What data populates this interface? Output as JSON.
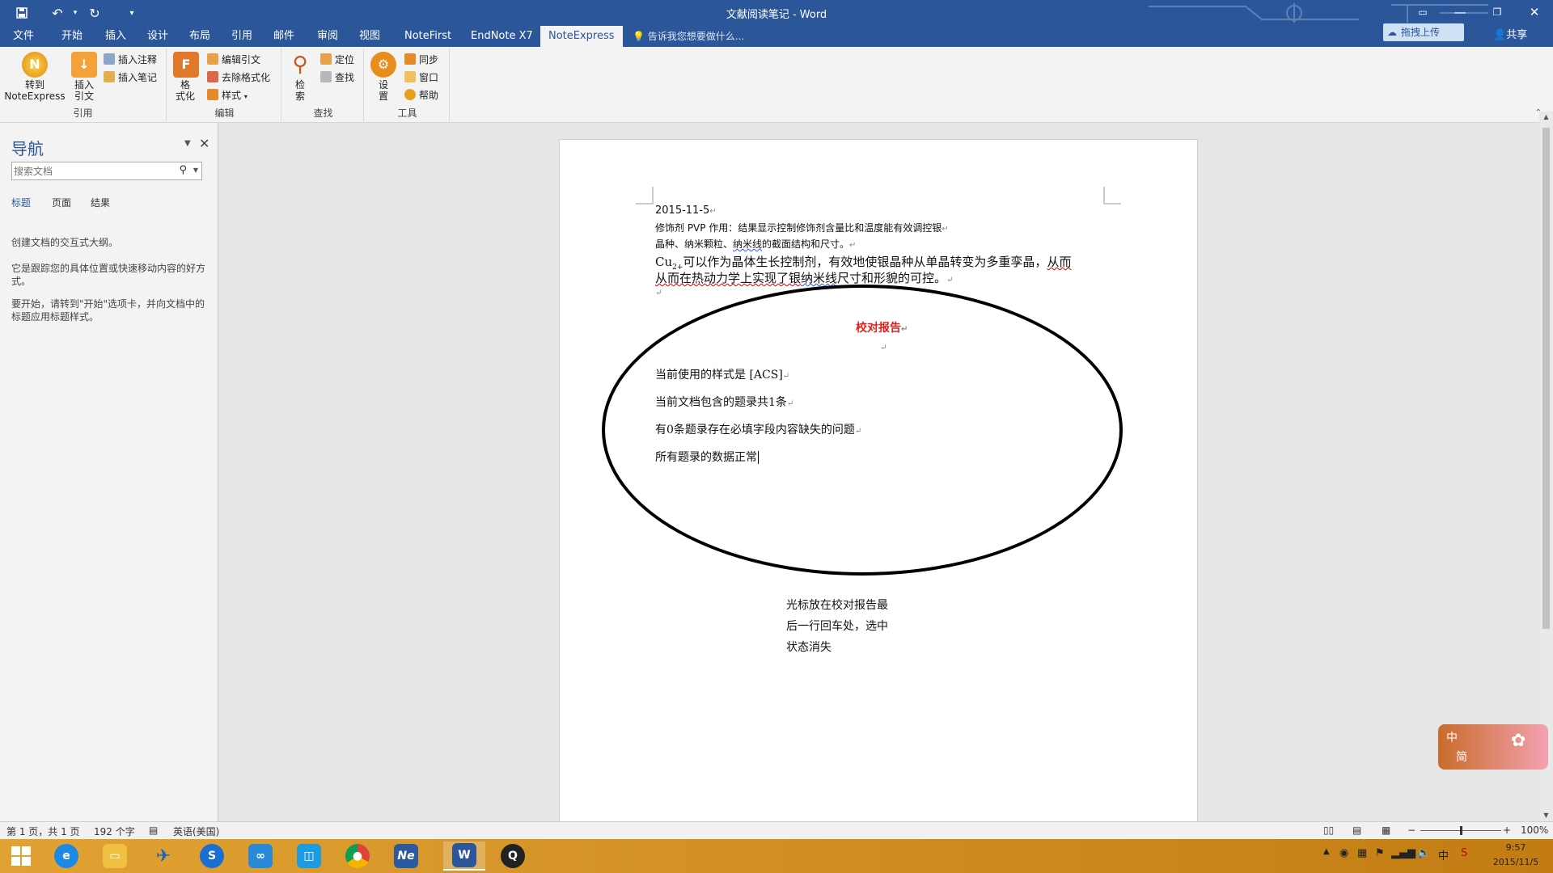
{
  "window": {
    "title": "文献阅读笔记 - Word",
    "quick_access": {
      "save": "save-icon",
      "undo": "undo-icon",
      "redo": "redo-icon",
      "customize": "customize-icon"
    }
  },
  "tabs": [
    "文件",
    "开始",
    "插入",
    "设计",
    "布局",
    "引用",
    "邮件",
    "审阅",
    "视图",
    "NoteFirst",
    "EndNote X7",
    "NoteExpress"
  ],
  "active_tab": "NoteExpress",
  "tellme": "告诉我您想要做什么...",
  "upload_label": "拖拽上传",
  "share_label": "共享",
  "ribbon": {
    "goto_label_1": "转到",
    "goto_label_2": "NoteExpress",
    "insert_cite_1": "插入",
    "insert_cite_2": "引文",
    "insert_note": "插入注释",
    "insert_memo": "插入笔记",
    "group_cite": "引用",
    "format_1": "格",
    "format_2": "式化",
    "edit_cite": "编辑引文",
    "remove_format": "去除格式化",
    "style": "样式",
    "group_edit": "编辑",
    "search_1": "检",
    "search_2": "索",
    "locate": "定位",
    "find": "查找",
    "group_find": "查找",
    "settings_1": "设",
    "settings_2": "置",
    "sync": "同步",
    "window": "窗口",
    "help": "帮助",
    "group_tools": "工具"
  },
  "nav": {
    "title": "导航",
    "search_placeholder": "搜索文档",
    "tabs": [
      "标题",
      "页面",
      "结果"
    ],
    "para1": "创建文档的交互式大纲。",
    "para2": "它是跟踪您的具体位置或快速移动内容的好方式。",
    "para3": "要开始，请转到\"开始\"选项卡，并向文档中的标题应用标题样式。"
  },
  "document": {
    "date": "2015-11-5",
    "line1": "修饰剂 PVP 作用：结果显示控制修饰剂含量比和温度能有效调控银",
    "line2_a": "晶种、纳米颗粒、",
    "line2_b": "纳米线",
    "line2_c": "的截面结构和尺寸。",
    "line3_a": "Cu",
    "line3_sub": "2+",
    "line3_b": "可以作为晶体生长控制剂，有效地使银晶种从单晶转变为多重孪晶，",
    "line3_c": "从而",
    "line4_a": "从而在热动力学上实现了银",
    "line4_b": "纳米线",
    "line4_c": "尺寸和形貌的可控。",
    "report_title": "校对报告",
    "report_style": "当前使用的样式是  [ACS]",
    "report_count": "当前文档包含的题录共1条",
    "report_missing": "有0条题录存在必填字段内容缺失的问题",
    "report_ok": "所有题录的数据正常"
  },
  "annotation": [
    "光标放在校对报告最",
    "后一行回车处，选中",
    "状态消失"
  ],
  "ime": {
    "lang": "中",
    "mode": "简"
  },
  "status": {
    "page": "第 1 页，共 1 页",
    "words": "192 个字",
    "language": "英语(美国)",
    "zoom": "100%",
    "zoom_level": 1.0
  },
  "clock": {
    "time": "9:57",
    "date": "2015/11/5"
  },
  "colors": {
    "word_blue": "#2b579a",
    "report_red": "#e0201a",
    "taskbar": "#d8901f"
  }
}
